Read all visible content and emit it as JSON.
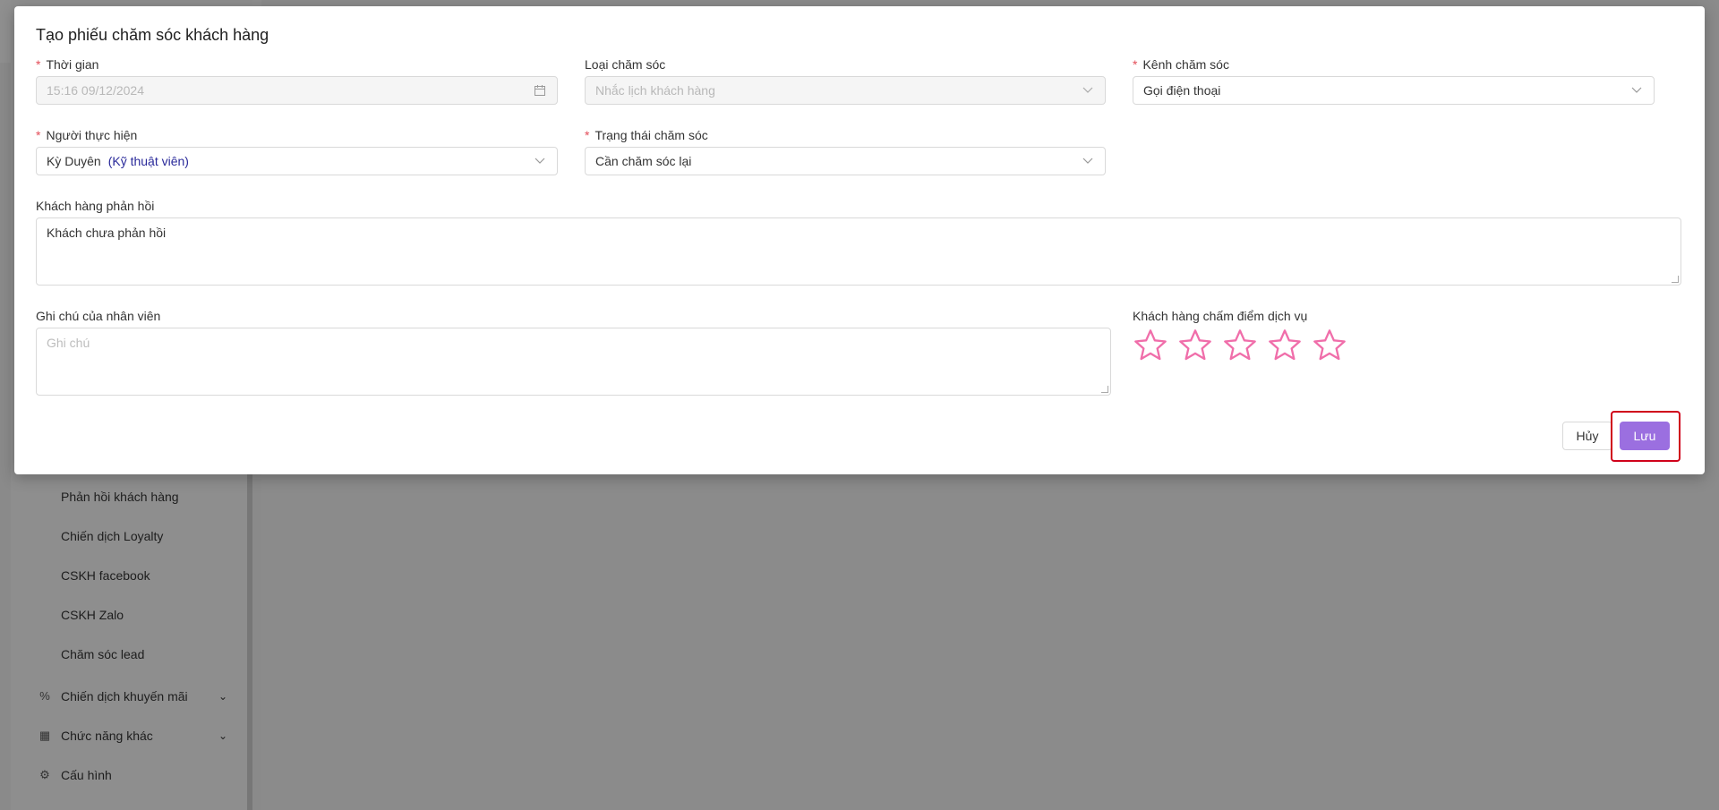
{
  "modal": {
    "title": "Tạo phiếu chăm sóc khách hàng",
    "fields": {
      "time": {
        "label": "Thời gian",
        "value": "15:16 09/12/2024",
        "required": true
      },
      "care_type": {
        "label": "Loại chăm sóc",
        "value": "Nhắc lịch khách hàng",
        "required": false
      },
      "care_channel": {
        "label": "Kênh chăm sóc",
        "value": "Gọi điện thoại",
        "required": true
      },
      "performer": {
        "label": "Người thực hiện",
        "value": "Kỳ Duyên",
        "role": "(Kỹ thuật viên)",
        "required": true
      },
      "care_status": {
        "label": "Trạng thái chăm sóc",
        "value": "Cần chăm sóc lại",
        "required": true
      },
      "customer_feedback": {
        "label": "Khách hàng phản hồi",
        "value": "Khách chưa phản hồi"
      },
      "staff_note": {
        "label": "Ghi chú của nhân viên",
        "placeholder": "Ghi chú"
      },
      "rating": {
        "label": "Khách hàng chấm điểm dịch vụ",
        "max": 5,
        "value": 0,
        "star_color": "#f06eaa"
      }
    },
    "required_mark": "*",
    "buttons": {
      "cancel": "Hủy",
      "save": "Lưu"
    }
  },
  "sidebar": {
    "sub_items": [
      "Phản hồi khách hàng",
      "Chiến dịch Loyalty",
      "CSKH facebook",
      "CSKH Zalo",
      "Chăm sóc lead"
    ],
    "items": [
      {
        "label": "Chiến dịch khuyến mãi",
        "icon": "percent-icon",
        "expandable": true
      },
      {
        "label": "Chức năng khác",
        "icon": "grid-icon",
        "expandable": true
      },
      {
        "label": "Cấu hình",
        "icon": "gear-icon",
        "expandable": false
      }
    ]
  },
  "colors": {
    "accent": "#9b6fe0",
    "required": "#e34d59",
    "highlight": "#d0021b"
  }
}
